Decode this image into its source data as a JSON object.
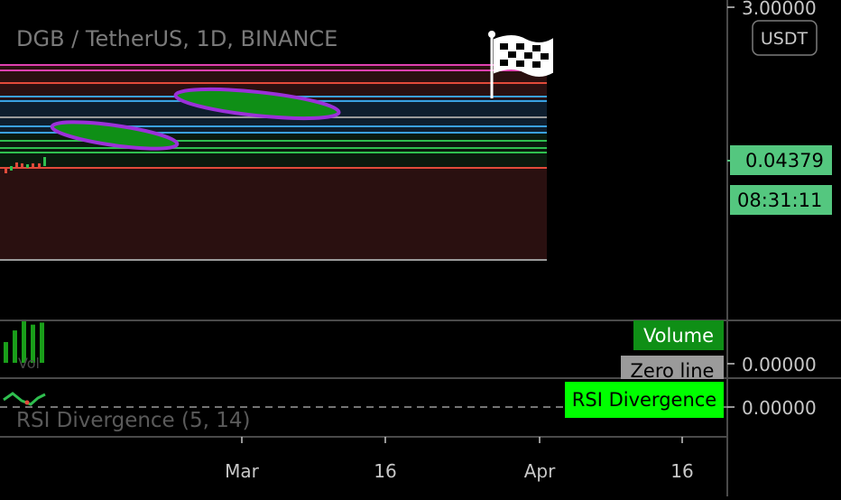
{
  "header": {
    "symbol_title": "DGB / TetherUS, 1D, BINANCE"
  },
  "price_axis": {
    "top_label": "3.00000",
    "currency_label": "USDT",
    "last_price": "0.04379",
    "countdown": "08:31:11"
  },
  "volume_pane": {
    "volume_tag": "Volume",
    "zero_line_tag": "Zero line",
    "axis_value": "0.00000",
    "legend_partial": "Vol"
  },
  "rsi_pane": {
    "title": "RSI Divergence (5, 14)",
    "tag": "RSI Divergence",
    "axis_value": "0.00000"
  },
  "time_axis": {
    "labels": [
      "Mar",
      "16",
      "Apr",
      "16"
    ]
  },
  "colors": {
    "background": "#000000",
    "grid": "#4a4a4a",
    "zone_fill": "#2a1010",
    "band_fill": "#0e1e2e",
    "highlight_fill": "#0f8f16",
    "highlight_stroke": "#9b30d9",
    "price_tag": "#54c77f",
    "volume_green": "#1a9e1a",
    "volume_tag_bg": "#0f8f16",
    "zero_tag_bg": "#9a9a9a",
    "rsi_tag_bg": "#00ff00",
    "muted_text": "#7a7a7a",
    "axis_text": "#c8c8c8"
  },
  "icons": {
    "finish_flag": "checkered-flag-icon"
  },
  "chart_data": {
    "type": "line",
    "title": "DGB / TetherUS, 1D, BINANCE",
    "xlabel": "",
    "ylabel": "",
    "x_ticks": [
      "Mar",
      "16",
      "Apr",
      "16"
    ],
    "last_price": 0.04379,
    "horizontal_levels": [
      {
        "color": "#e040b0"
      },
      {
        "color": "#e040b0"
      },
      {
        "color": "#e04a3a"
      },
      {
        "color": "#3aa0e0"
      },
      {
        "color": "#3aa0e0"
      },
      {
        "color": "#9a9a9a"
      },
      {
        "color": "#3aa0e0"
      },
      {
        "color": "#3aa0e0"
      },
      {
        "color": "#2fbf4f"
      },
      {
        "color": "#2fbf4f"
      },
      {
        "color": "#2fbf4f"
      },
      {
        "color": "#e04a3a"
      },
      {
        "color": "#9a9a9a"
      }
    ],
    "volume_bars": [
      0.5,
      0.78,
      1.0,
      0.92,
      0.97
    ],
    "grid": true,
    "legend": "none"
  }
}
